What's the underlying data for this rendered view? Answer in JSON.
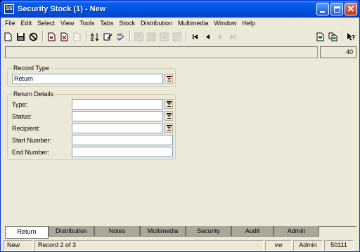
{
  "window": {
    "title": "Security Stock (1) - New",
    "app_icon_text": "SS"
  },
  "menu": [
    "File",
    "Edit",
    "Select",
    "View",
    "Tools",
    "Tabs",
    "Stock",
    "Distribution",
    "Multimedia",
    "Window",
    "Help"
  ],
  "infobar": {
    "right_value": "40"
  },
  "record_type": {
    "group_label": "Record Type",
    "value": "Return"
  },
  "return_details": {
    "group_label": "Return Details",
    "fields": [
      {
        "label": "Type:",
        "value": ""
      },
      {
        "label": "Status:",
        "value": ""
      },
      {
        "label": "Recipient:",
        "value": ""
      },
      {
        "label": "Start Number:",
        "value": ""
      },
      {
        "label": "End Number:",
        "value": ""
      }
    ]
  },
  "tabs": [
    "Return",
    "Distribution",
    "Notes",
    "Multimedia",
    "Security",
    "Audit",
    "Admin"
  ],
  "active_tab": "Return",
  "status": {
    "mode": "New",
    "record": "Record 2 of 3",
    "user": "vw",
    "role": "Admin",
    "id": "50111"
  },
  "colors": {
    "titlebar": "#0055e5",
    "window_bg": "#ece9d8",
    "inactive_tab": "#aca899"
  }
}
